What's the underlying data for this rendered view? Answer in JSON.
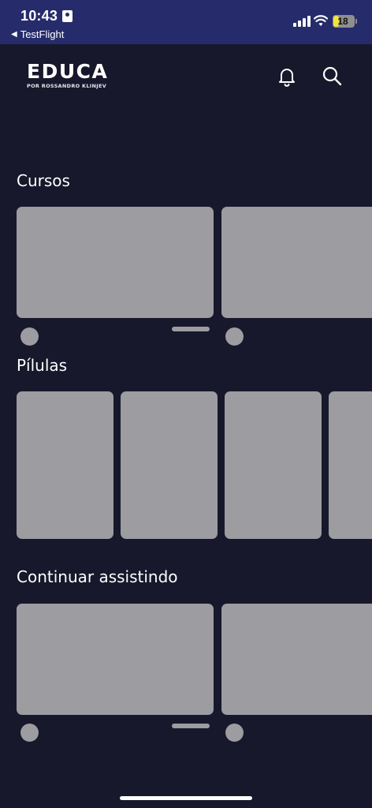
{
  "status_bar": {
    "time": "10:43",
    "back_label": "TestFlight",
    "battery": "18"
  },
  "header": {
    "logo_title": "EDUCA",
    "logo_subtitle": "POR ROSSANDRO KLINJEV"
  },
  "sections": {
    "courses": {
      "title": "Cursos"
    },
    "pills": {
      "title": "Pílulas"
    },
    "continue": {
      "title": "Continuar assistindo"
    }
  },
  "colors": {
    "background": "#17182b",
    "status_bar": "#262b6b",
    "placeholder": "#9c9ca1",
    "text": "#ffffff"
  }
}
